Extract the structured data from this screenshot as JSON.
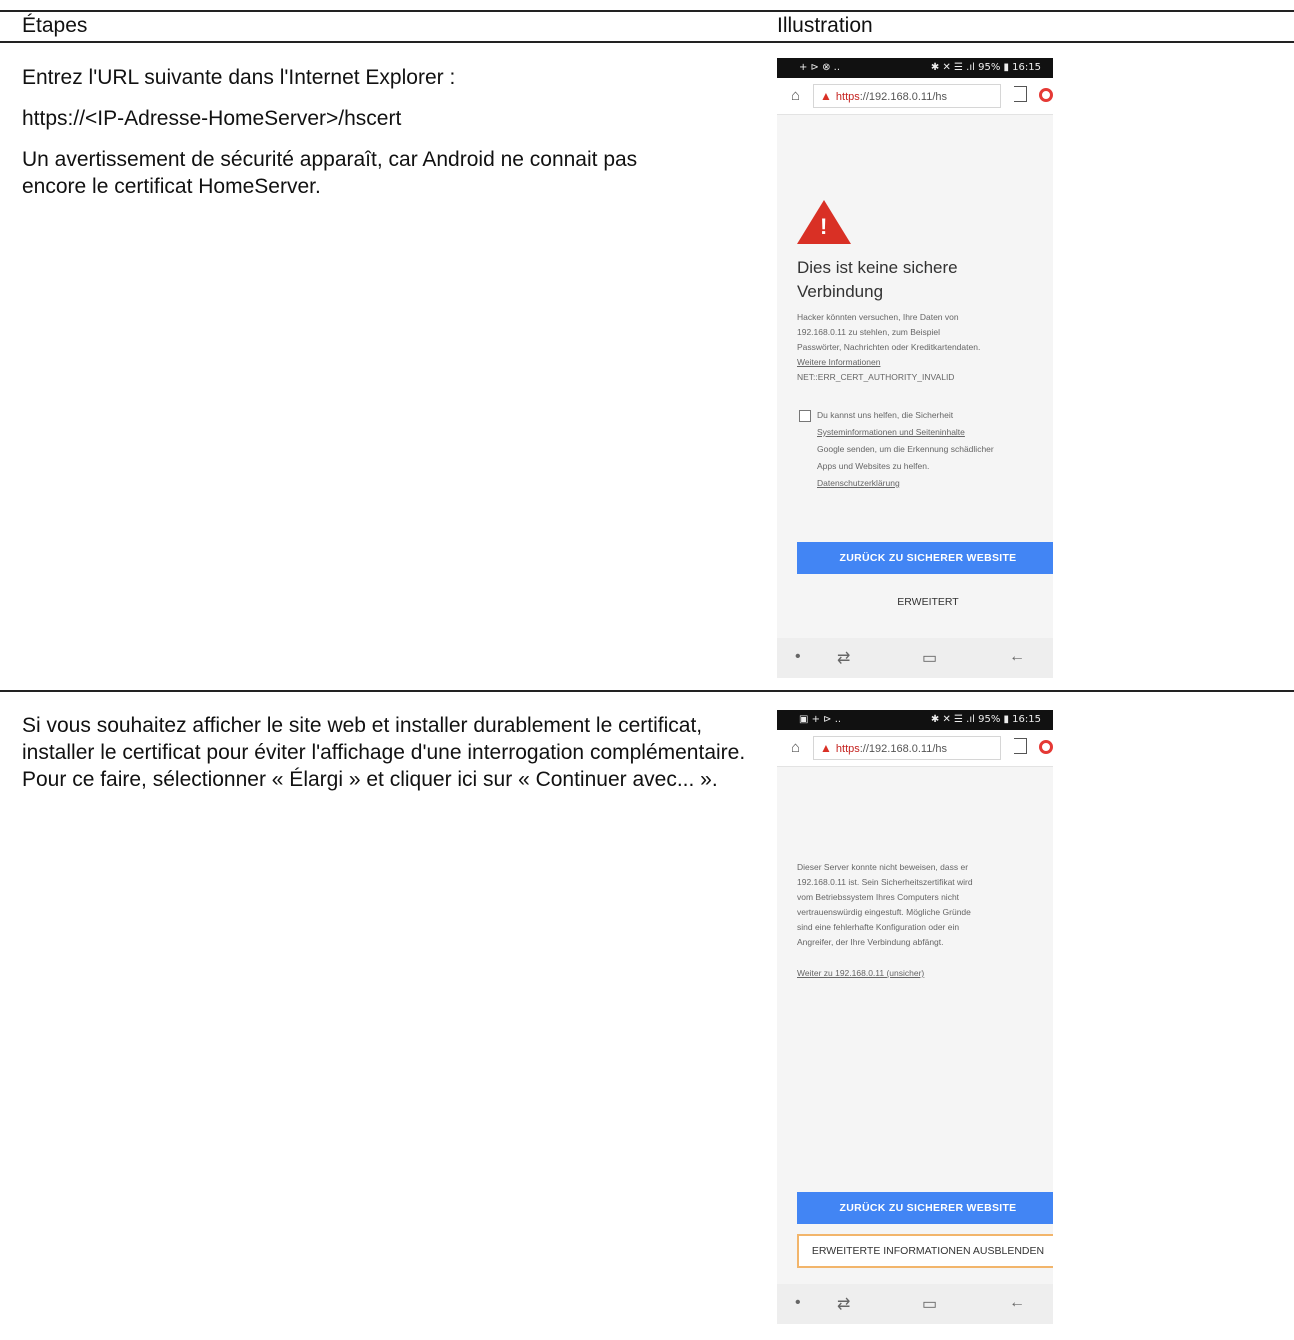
{
  "header": {
    "col_steps": "Étapes",
    "col_illustration": "Illustration"
  },
  "rows": [
    {
      "paragraphs": [
        "Entrez l'URL suivante dans l'Internet Explorer :",
        "https://<IP-Adresse-HomeServer>/hscert",
        "Un avertissement de sécurité apparaît, car Android ne connait pas encore le certificat HomeServer."
      ],
      "phone": {
        "status_left": "+ ⊳ ⊗ ..",
        "status_right": "✱ ✕ ☰ .ıl 95% ▮ 16:15",
        "url_https": "https",
        "url_rest": "://192.168.0.11/hs",
        "warning_title": "Dies ist keine sichere Verbindung",
        "warning_text": [
          "Hacker könnten versuchen, Ihre Daten von",
          "192.168.0.11 zu stehlen, zum Beispiel",
          "Passwörter, Nachrichten oder Kreditkartendaten.",
          "Weitere Informationen",
          "NET::ERR_CERT_AUTHORITY_INVALID"
        ],
        "checkbox_lines": [
          "Du kannst uns helfen, die Sicherheit",
          "Systeminformationen und Seiteninhalte",
          "Google senden, um die Erkennung schädlicher",
          "Apps und Websites zu helfen.",
          "Datenschutzerklärung"
        ],
        "primary_button": "ZURÜCK ZU SICHERER WEBSITE",
        "secondary_button": "ERWEITERT"
      }
    },
    {
      "paragraphs": [
        "Si vous souhaitez afficher le site web et installer durablement le certificat, installer le certificat pour éviter l'affichage d'une interrogation complémentaire. Pour ce faire, sélectionner « Élargi » et cliquer ici sur « Continuer avec... »."
      ],
      "phone": {
        "status_left": "▣ + ⊳ ..",
        "status_right": "✱ ✕ ☰ .ıl 95% ▮ 16:15",
        "url_https": "https",
        "url_rest": "://192.168.0.11/hs",
        "details_text": [
          "Dieser Server konnte nicht beweisen, dass er",
          "192.168.0.11 ist. Sein Sicherheitszertifikat wird",
          "vom Betriebssystem Ihres Computers nicht",
          "vertrauenswürdig eingestuft. Mögliche Gründe",
          "sind eine fehlerhafte Konfiguration oder ein",
          "Angreifer, der Ihre Verbindung abfängt.",
          "",
          "Weiter zu 192.168.0.11 (unsicher)"
        ],
        "primary_button": "ZURÜCK ZU SICHERER WEBSITE",
        "secondary_button": "ERWEITERTE INFORMATIONEN AUSBLENDEN"
      }
    }
  ],
  "nav_icons": [
    "•",
    "⇄",
    "▭",
    "←"
  ],
  "colors": {
    "accent_blue": "#4285f4",
    "warning_red": "#d93025",
    "outline_orange": "#f2b56b"
  }
}
